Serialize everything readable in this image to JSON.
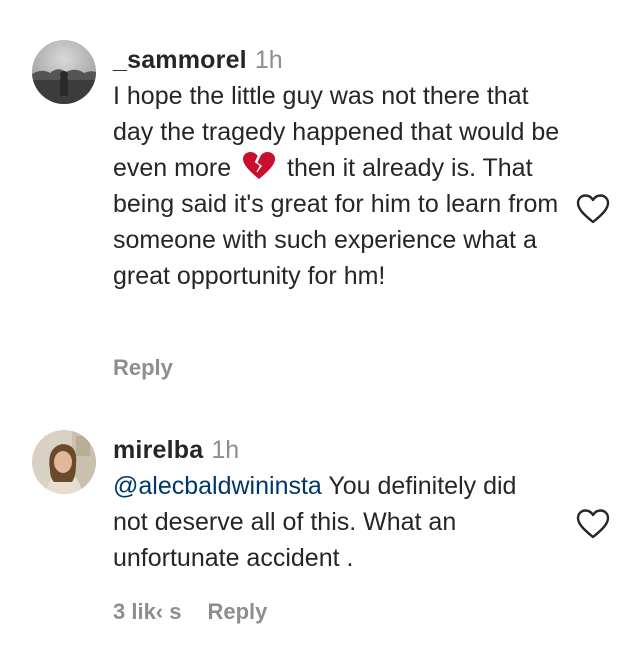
{
  "comments": [
    {
      "username": "_sammorel",
      "time": "1h",
      "text_before_emoji": "I hope the little guy was not there that day the tragedy happened that would be even more",
      "emoji": "broken-heart-emoji",
      "text_after_emoji": " then it already is. That being said it's great for him to learn from someone with such experience what a great opportunity for hm!",
      "reply_label": "Reply",
      "like_icon": "heart-outline-icon"
    },
    {
      "username": "mirelba",
      "time": "1h",
      "mention": "@alecbaldwininsta",
      "text": " You definitely did not deserve all of this. What an unfortunate accident .",
      "likes_label": "3 lik‹ s",
      "reply_label": "Reply",
      "like_icon": "heart-outline-icon"
    }
  ]
}
